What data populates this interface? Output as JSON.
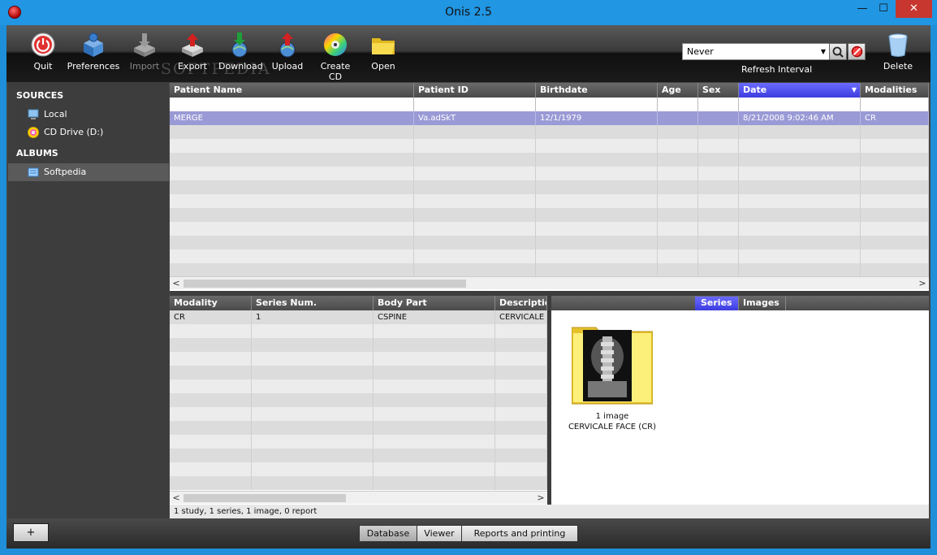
{
  "window": {
    "title": "Onis 2.5",
    "minimize": "—",
    "maximize": "☐",
    "close": "✕"
  },
  "toolbar": {
    "buttons": [
      {
        "label": "Quit",
        "icon": "power-icon",
        "enabled": true
      },
      {
        "label": "Preferences",
        "icon": "preferences-icon",
        "enabled": true
      },
      {
        "label": "Import",
        "icon": "import-icon",
        "enabled": false
      },
      {
        "label": "Export",
        "icon": "export-icon",
        "enabled": true
      },
      {
        "label": "Download",
        "icon": "download-icon",
        "enabled": true
      },
      {
        "label": "Upload",
        "icon": "upload-icon",
        "enabled": true
      },
      {
        "label": "Create CD",
        "icon": "cd-icon",
        "enabled": true
      },
      {
        "label": "Open",
        "icon": "folder-icon",
        "enabled": true
      }
    ],
    "refresh_value": "Never",
    "refresh_label": "Refresh Interval",
    "delete_label": "Delete"
  },
  "watermark": "SOFTPEDIA",
  "sidebar": {
    "sources_heading": "SOURCES",
    "sources": [
      {
        "label": "Local",
        "icon": "computer-icon"
      },
      {
        "label": "CD Drive (D:)",
        "icon": "cd-drive-icon"
      }
    ],
    "albums_heading": "ALBUMS",
    "albums": [
      {
        "label": "Softpedia",
        "icon": "album-icon",
        "selected": true
      }
    ]
  },
  "studies": {
    "columns": [
      "Patient Name",
      "Patient ID",
      "Birthdate",
      "Age",
      "Sex",
      "Date",
      "Modalities"
    ],
    "sorted_column": "Date",
    "rows": [
      [
        "MERGE",
        "Va.adSkT",
        "12/1/1979",
        "",
        "",
        "8/21/2008 9:02:46 AM",
        "CR"
      ]
    ]
  },
  "series": {
    "columns": [
      "Modality",
      "Series Num.",
      "Body Part",
      "Descriptio"
    ],
    "rows": [
      [
        "CR",
        "1",
        "CSPINE",
        "CERVICALE"
      ]
    ]
  },
  "preview": {
    "tabs": [
      "Series",
      "Images"
    ],
    "active_tab": "Series",
    "item_count": "1 image",
    "item_name": "CERVICALE FACE (CR)"
  },
  "status": "1 study, 1 series, 1 image, 0 report",
  "bottom": {
    "add_label": "+",
    "tabs": [
      "Database",
      "Viewer",
      "Reports and printing"
    ],
    "active_tab": "Database"
  }
}
